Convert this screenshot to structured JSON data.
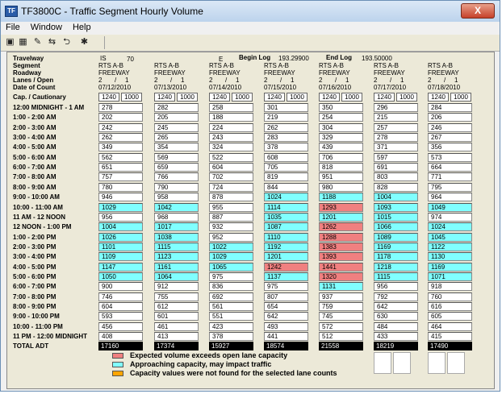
{
  "window": {
    "title": "TF3800C - Traffic Segment Hourly Volume",
    "close_label": "X",
    "app_icon": "TF"
  },
  "menu": [
    "File",
    "Window",
    "Help"
  ],
  "toolbar": [
    {
      "name": "print-icon",
      "glyph": "▣"
    },
    {
      "name": "report-icon",
      "glyph": "▦"
    },
    {
      "name": "tools-icon",
      "glyph": "✎"
    },
    {
      "name": "getlog-icon",
      "glyph": "⇆"
    },
    {
      "name": "return-icon",
      "glyph": "⮌"
    },
    {
      "name": "settings-icon",
      "glyph": "✱"
    }
  ],
  "header": {
    "travelway_label": "Travelway",
    "segment_label": "Segment",
    "roadway_label": "Roadway",
    "lanes_label": "Lanes / Open",
    "date_label": "Date of Count",
    "cap_label": "Cap. / Cautionary",
    "travelway_is": "IS",
    "travelway_num": "70",
    "direction": "E",
    "begin_log_label": "Begin Log",
    "begin_log_value": "193.29900",
    "end_log_label": "End Log",
    "end_log_value": "193.50000"
  },
  "colors": {
    "red": "#f08080",
    "cyan": "#80ffff",
    "orange": "#ffa500",
    "white": "#ffffff"
  },
  "days": [
    {
      "segment": "RTS A-B",
      "roadway": "FREEWAY",
      "lanes": "2",
      "sep": "/",
      "open": "1",
      "date": "07/12/2010",
      "cap1": "1240",
      "cap2": "1000",
      "total": "17160"
    },
    {
      "segment": "RTS A-B",
      "roadway": "FREEWAY",
      "lanes": "2",
      "sep": "/",
      "open": "1",
      "date": "07/13/2010",
      "cap1": "1240",
      "cap2": "1000",
      "total": "17374"
    },
    {
      "segment": "RTS A-B",
      "roadway": "FREEWAY",
      "lanes": "2",
      "sep": "/",
      "open": "1",
      "date": "07/14/2010",
      "cap1": "1240",
      "cap2": "1000",
      "total": "15927"
    },
    {
      "segment": "RTS A-B",
      "roadway": "FREEWAY",
      "lanes": "2",
      "sep": "/",
      "open": "1",
      "date": "07/15/2010",
      "cap1": "1240",
      "cap2": "1000",
      "total": "18574"
    },
    {
      "segment": "RTS A-B",
      "roadway": "FREEWAY",
      "lanes": "2",
      "sep": "/",
      "open": "1",
      "date": "07/16/2010",
      "cap1": "1240",
      "cap2": "1000",
      "total": "21558"
    },
    {
      "segment": "RTS A-B",
      "roadway": "FREEWAY",
      "lanes": "2",
      "sep": "/",
      "open": "1",
      "date": "07/17/2010",
      "cap1": "1240",
      "cap2": "1000",
      "total": "18219"
    },
    {
      "segment": "RTS A-B",
      "roadway": "FREEWAY",
      "lanes": "2",
      "sep": "/",
      "open": "1",
      "date": "07/18/2010",
      "cap1": "1240",
      "cap2": "1000",
      "total": "17490"
    }
  ],
  "hours": [
    {
      "label": "12:00 MIDNIGHT - 1 AM",
      "values": [
        "278",
        "282",
        "258",
        "301",
        "350",
        "296",
        "284"
      ],
      "status": [
        "w",
        "w",
        "w",
        "w",
        "w",
        "w",
        "w"
      ]
    },
    {
      "label": "1:00 - 2:00 AM",
      "values": [
        "202",
        "205",
        "188",
        "219",
        "254",
        "215",
        "206"
      ],
      "status": [
        "w",
        "w",
        "w",
        "w",
        "w",
        "w",
        "w"
      ]
    },
    {
      "label": "2:00 - 3:00 AM",
      "values": [
        "242",
        "245",
        "224",
        "262",
        "304",
        "257",
        "246"
      ],
      "status": [
        "w",
        "w",
        "w",
        "w",
        "w",
        "w",
        "w"
      ]
    },
    {
      "label": "3:00 - 4:00 AM",
      "values": [
        "262",
        "265",
        "243",
        "283",
        "329",
        "278",
        "267"
      ],
      "status": [
        "w",
        "w",
        "w",
        "w",
        "w",
        "w",
        "w"
      ]
    },
    {
      "label": "4:00 - 5:00 AM",
      "values": [
        "349",
        "354",
        "324",
        "378",
        "439",
        "371",
        "356"
      ],
      "status": [
        "w",
        "w",
        "w",
        "w",
        "w",
        "w",
        "w"
      ]
    },
    {
      "label": "5:00 - 6:00 AM",
      "values": [
        "562",
        "569",
        "522",
        "608",
        "706",
        "597",
        "573"
      ],
      "status": [
        "w",
        "w",
        "w",
        "w",
        "w",
        "w",
        "w"
      ]
    },
    {
      "label": "6:00 - 7:00 AM",
      "values": [
        "651",
        "659",
        "604",
        "705",
        "818",
        "691",
        "664"
      ],
      "status": [
        "w",
        "w",
        "w",
        "w",
        "w",
        "w",
        "w"
      ]
    },
    {
      "label": "7:00 - 8:00 AM",
      "values": [
        "757",
        "766",
        "702",
        "819",
        "951",
        "803",
        "771"
      ],
      "status": [
        "w",
        "w",
        "w",
        "w",
        "w",
        "w",
        "w"
      ]
    },
    {
      "label": "8:00 - 9:00 AM",
      "values": [
        "780",
        "790",
        "724",
        "844",
        "980",
        "828",
        "795"
      ],
      "status": [
        "w",
        "w",
        "w",
        "w",
        "w",
        "w",
        "w"
      ]
    },
    {
      "label": "9:00 - 10:00 AM",
      "values": [
        "946",
        "958",
        "878",
        "1024",
        "1188",
        "1004",
        "964"
      ],
      "status": [
        "w",
        "w",
        "w",
        "c",
        "c",
        "c",
        "w"
      ]
    },
    {
      "label": "10:00 - 11:00 AM",
      "values": [
        "1029",
        "1042",
        "955",
        "1114",
        "1293",
        "1093",
        "1049"
      ],
      "status": [
        "c",
        "c",
        "w",
        "c",
        "r",
        "c",
        "c"
      ]
    },
    {
      "label": "11 AM - 12 NOON",
      "values": [
        "956",
        "968",
        "887",
        "1035",
        "1201",
        "1015",
        "974"
      ],
      "status": [
        "w",
        "w",
        "w",
        "c",
        "c",
        "c",
        "w"
      ]
    },
    {
      "label": "12 NOON - 1:00 PM",
      "values": [
        "1004",
        "1017",
        "932",
        "1087",
        "1262",
        "1066",
        "1024"
      ],
      "status": [
        "c",
        "c",
        "w",
        "c",
        "r",
        "c",
        "c"
      ]
    },
    {
      "label": "1:00 - 2:00 PM",
      "values": [
        "1026",
        "1038",
        "952",
        "1110",
        "1288",
        "1089",
        "1045"
      ],
      "status": [
        "c",
        "c",
        "w",
        "c",
        "r",
        "c",
        "c"
      ]
    },
    {
      "label": "2:00 - 3:00 PM",
      "values": [
        "1101",
        "1115",
        "1022",
        "1192",
        "1383",
        "1169",
        "1122"
      ],
      "status": [
        "c",
        "c",
        "c",
        "c",
        "r",
        "c",
        "c"
      ]
    },
    {
      "label": "3:00 - 4:00 PM",
      "values": [
        "1109",
        "1123",
        "1029",
        "1201",
        "1393",
        "1178",
        "1130"
      ],
      "status": [
        "c",
        "c",
        "c",
        "c",
        "r",
        "c",
        "c"
      ]
    },
    {
      "label": "4:00 - 5:00 PM",
      "values": [
        "1147",
        "1161",
        "1065",
        "1242",
        "1441",
        "1218",
        "1169"
      ],
      "status": [
        "c",
        "c",
        "c",
        "r",
        "r",
        "c",
        "c"
      ]
    },
    {
      "label": "5:00 - 6:00 PM",
      "values": [
        "1050",
        "1064",
        "975",
        "1137",
        "1320",
        "1115",
        "1071"
      ],
      "status": [
        "c",
        "c",
        "w",
        "c",
        "r",
        "c",
        "c"
      ]
    },
    {
      "label": "6:00 - 7:00 PM",
      "values": [
        "900",
        "912",
        "836",
        "975",
        "1131",
        "956",
        "918"
      ],
      "status": [
        "w",
        "w",
        "w",
        "w",
        "c",
        "w",
        "w"
      ]
    },
    {
      "label": "7:00 - 8:00 PM",
      "values": [
        "746",
        "755",
        "692",
        "807",
        "937",
        "792",
        "760"
      ],
      "status": [
        "w",
        "w",
        "w",
        "w",
        "w",
        "w",
        "w"
      ]
    },
    {
      "label": "8:00 - 9:00 PM",
      "values": [
        "604",
        "612",
        "561",
        "654",
        "759",
        "642",
        "616"
      ],
      "status": [
        "w",
        "w",
        "w",
        "w",
        "w",
        "w",
        "w"
      ]
    },
    {
      "label": "9:00 - 10:00 PM",
      "values": [
        "593",
        "601",
        "551",
        "642",
        "745",
        "630",
        "605"
      ],
      "status": [
        "w",
        "w",
        "w",
        "w",
        "w",
        "w",
        "w"
      ]
    },
    {
      "label": "10:00 - 11:00 PM",
      "values": [
        "456",
        "461",
        "423",
        "493",
        "572",
        "484",
        "464"
      ],
      "status": [
        "w",
        "w",
        "w",
        "w",
        "w",
        "w",
        "w"
      ]
    },
    {
      "label": "11 PM - 12:00 MIDNIGHT",
      "values": [
        "408",
        "413",
        "378",
        "441",
        "512",
        "433",
        "415"
      ],
      "status": [
        "w",
        "w",
        "w",
        "w",
        "w",
        "w",
        "w"
      ]
    }
  ],
  "total_label": "TOTAL ADT",
  "legend": [
    {
      "color": "#f08080",
      "text": "Expected volume exceeds open lane capacity"
    },
    {
      "color": "#80ffff",
      "text": "Approaching capacity, may impact traffic"
    },
    {
      "color": "#ffa500",
      "text": "Capacity values were not found for the selected lane counts"
    }
  ]
}
